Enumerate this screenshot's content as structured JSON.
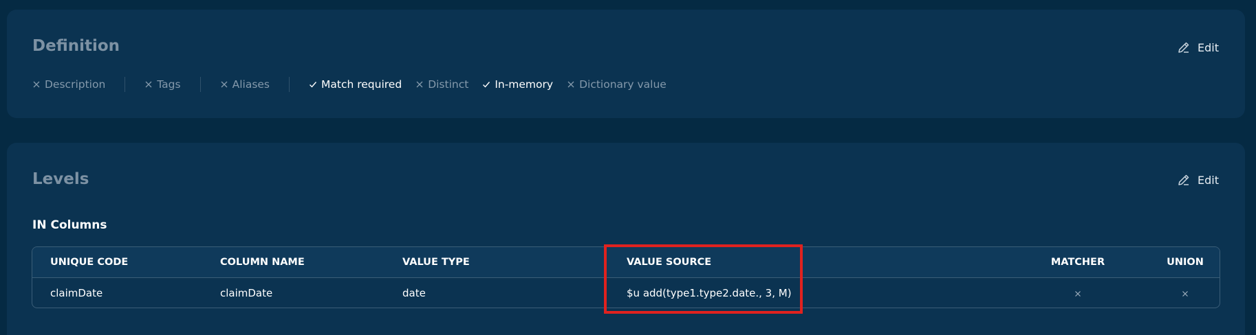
{
  "definition": {
    "title": "Definition",
    "edit_label": "Edit",
    "flags": [
      {
        "label": "Description",
        "state": "off"
      },
      {
        "label": "Tags",
        "state": "off"
      },
      {
        "label": "Aliases",
        "state": "off"
      },
      {
        "label": "Match required",
        "state": "on"
      },
      {
        "label": "Distinct",
        "state": "off"
      },
      {
        "label": "In-memory",
        "state": "on"
      },
      {
        "label": "Dictionary value",
        "state": "off"
      }
    ]
  },
  "levels": {
    "title": "Levels",
    "edit_label": "Edit",
    "section_title": "IN Columns",
    "columns": [
      "UNIQUE CODE",
      "COLUMN NAME",
      "VALUE TYPE",
      "VALUE SOURCE",
      "MATCHER",
      "UNION"
    ],
    "rows": [
      {
        "unique_code": "claimDate",
        "column_name": "claimDate",
        "value_type": "date",
        "value_source": "$u add(type1.type2.date., 3, M)",
        "matcher": "cross-icon",
        "union": "cross-icon"
      }
    ]
  },
  "colors": {
    "background": "#052a43",
    "card": "#0b3351",
    "muted_text": "#8499ab",
    "highlight": "#e0221f"
  }
}
